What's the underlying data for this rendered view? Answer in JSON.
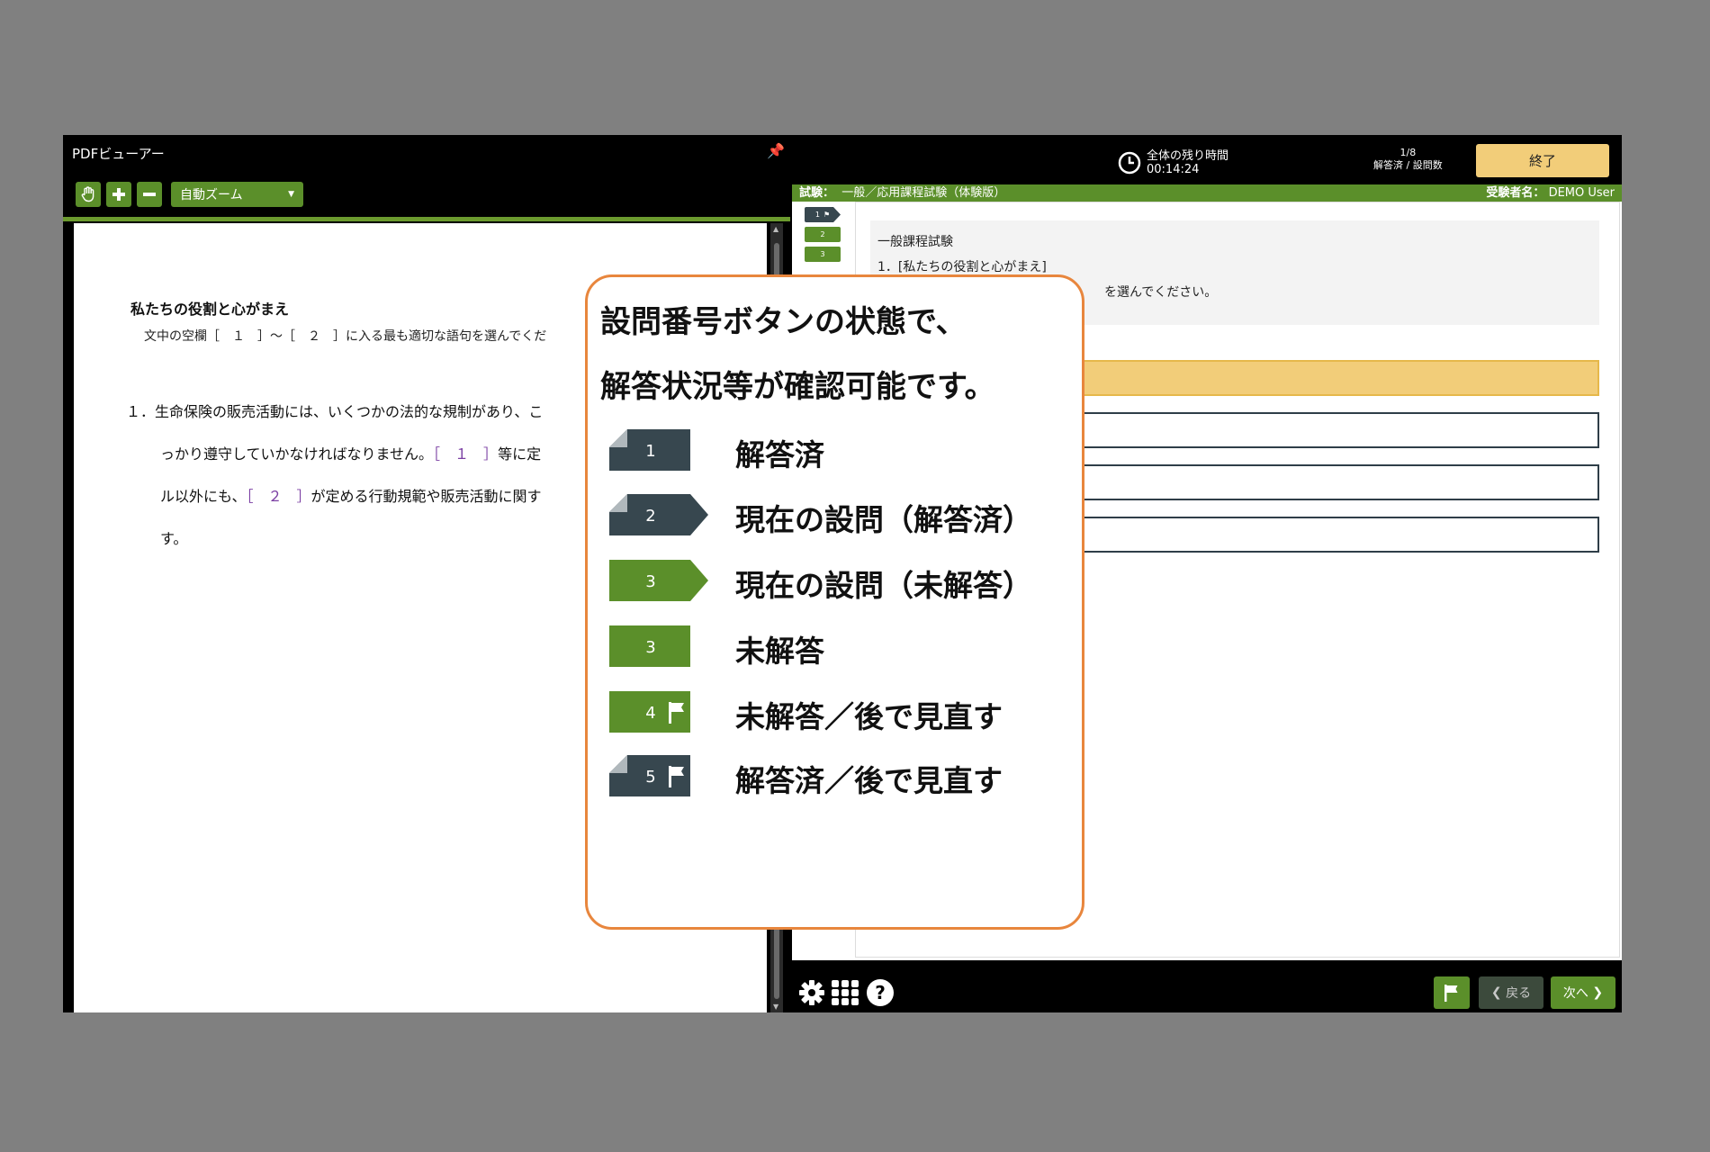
{
  "pdf_viewer": {
    "title": "PDFビューアー",
    "zoom_label": "自動ズーム",
    "document": {
      "heading": "私たちの役割と心がまえ",
      "instruction": "文中の空欄［　１　］～［　２　］に入る最も適切な語句を選んでくだ",
      "line1": "１．生命保険の販売活動には、いくつかの法的な規制があり、こ",
      "line2_a": "っかり遵守していかなければなりません。",
      "line2_blank": "［　１　］",
      "line2_b": "等に定",
      "line3_a": "ル以外にも、",
      "line3_blank": "［　２　］",
      "line3_b": "が定める行動規範や販売活動に関す",
      "line4": "す。"
    }
  },
  "timer": {
    "label": "全体の残り時間",
    "value": "00:14:24"
  },
  "progress": {
    "fraction": "1/8",
    "label": "解答済 / 設問数"
  },
  "end_button": "終了",
  "exam_bar": {
    "label": "試験：",
    "exam_name": "一般／応用課程試験（体験版）",
    "examinee_label": "受験者名：",
    "examinee_name": "DEMO User"
  },
  "question_nav": [
    "1",
    "2",
    "3"
  ],
  "question": {
    "section": "一般課程試験",
    "title": "1．[私たちの役割と心がまえ]",
    "instruction_tail": "を選んでください。"
  },
  "footer": {
    "back_label": "戻る",
    "next_label": "次へ"
  },
  "callout": {
    "heading_line1": "設問番号ボタンの状態で、",
    "heading_line2": "解答状況等が確認可能です。",
    "legend": [
      {
        "num": "1",
        "label": "解答済",
        "style": "answered"
      },
      {
        "num": "2",
        "label": "現在の設問（解答済）",
        "style": "current-answered"
      },
      {
        "num": "3",
        "label": "現在の設問（未解答）",
        "style": "current-unanswered"
      },
      {
        "num": "3",
        "label": "未解答",
        "style": "unanswered"
      },
      {
        "num": "4",
        "label": "未解答／後で見直す",
        "style": "unanswered-flag"
      },
      {
        "num": "5",
        "label": "解答済／後で見直す",
        "style": "answered-flag"
      }
    ]
  },
  "colors": {
    "green": "#5b8f2a",
    "dark": "#37474f",
    "gold": "#f2cd79",
    "callout_border": "#e8863d"
  }
}
